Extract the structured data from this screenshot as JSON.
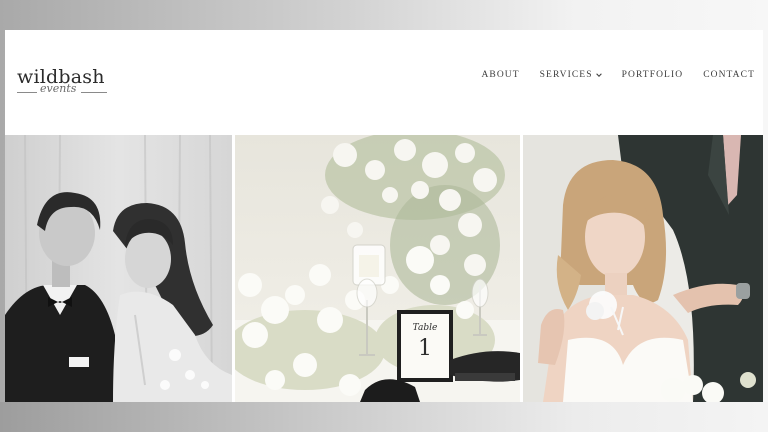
{
  "site": {
    "logo": {
      "word": "wildbash",
      "script": "events"
    },
    "nav": [
      {
        "label": "ABOUT"
      },
      {
        "label": "SERVICES",
        "has_dropdown": true
      },
      {
        "label": "PORTFOLIO"
      },
      {
        "label": "CONTACT"
      }
    ],
    "chevron_icon": "chevron-down-icon"
  },
  "gallery": {
    "photos": [
      {
        "subject": "couple-portrait",
        "tone": "black-and-white"
      },
      {
        "subject": "table-centerpiece",
        "tone": "soft-white-green",
        "card_text": {
          "title": "Table",
          "number": "1"
        }
      },
      {
        "subject": "bride-portrait",
        "tone": "warm-natural"
      }
    ]
  },
  "colors": {
    "nav_text": "#3d3d3d",
    "logo_text": "#2b2b2b",
    "page_bg": "#ffffff"
  }
}
